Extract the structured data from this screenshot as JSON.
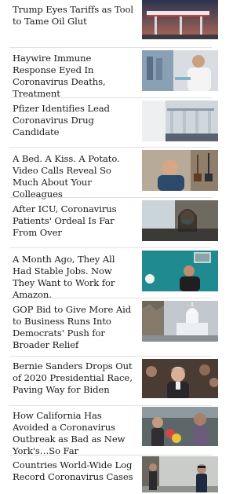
{
  "articles": [
    {
      "headline": "Trump Eyes Tariffs as Tool to Tame Oil Glut",
      "image": "gas-station-canopy-at-dusk"
    },
    {
      "headline": "Haywire Immune Response Eyed In Coronavirus Deaths, Treatment",
      "image": "lab-researcher-with-pipette"
    },
    {
      "headline": "Pfizer Identifies Lead Coronavirus Drug Candidate",
      "image": "lab-equipment"
    },
    {
      "headline": "A Bed. A Kiss. A Potato. Video Calls Reveal So Much About Your Colleagues",
      "image": "man-on-video-call-with-guitars"
    },
    {
      "headline": "After ICU, Coronavirus Patients' Ordeal Is Far From Over",
      "image": "woman-in-mask-in-car"
    },
    {
      "headline": "A Month Ago, They All Had Stable Jobs. Now They Want to Work for Amazon.",
      "image": "woman-at-home-teal-wall"
    },
    {
      "headline": "GOP Bid to Give More Aid to Business Runs Into Democrats' Push for Broader Relief",
      "image": "us-capitol-dome"
    },
    {
      "headline": "Bernie Sanders Drops Out of 2020 Presidential Race, Paving Way for Biden",
      "image": "bernie-sanders-crowd"
    },
    {
      "headline": "How California Has Avoided a Coronavirus Outbreak as Bad as New York's…So Far",
      "image": "people-in-masks-street"
    },
    {
      "headline": "Countries World-Wide Log Record Coronavirus Cases",
      "image": "police-officer-street"
    }
  ]
}
